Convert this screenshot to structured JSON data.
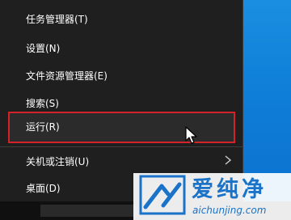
{
  "menu": {
    "items": [
      {
        "label": "任务管理器(T)"
      },
      {
        "label": "设置(N)"
      },
      {
        "label": "文件资源管理器(E)"
      },
      {
        "label": "搜索(S)"
      },
      {
        "label": "运行(R)"
      },
      {
        "label": "关机或注销(U)"
      },
      {
        "label": "桌面(D)"
      }
    ],
    "highlight_color": "#d2232a",
    "submenu_icon": "chevron-right-icon"
  },
  "watermark": {
    "title": "爱纯净",
    "url": "aichunjing.com",
    "color": "#1a73c8"
  }
}
